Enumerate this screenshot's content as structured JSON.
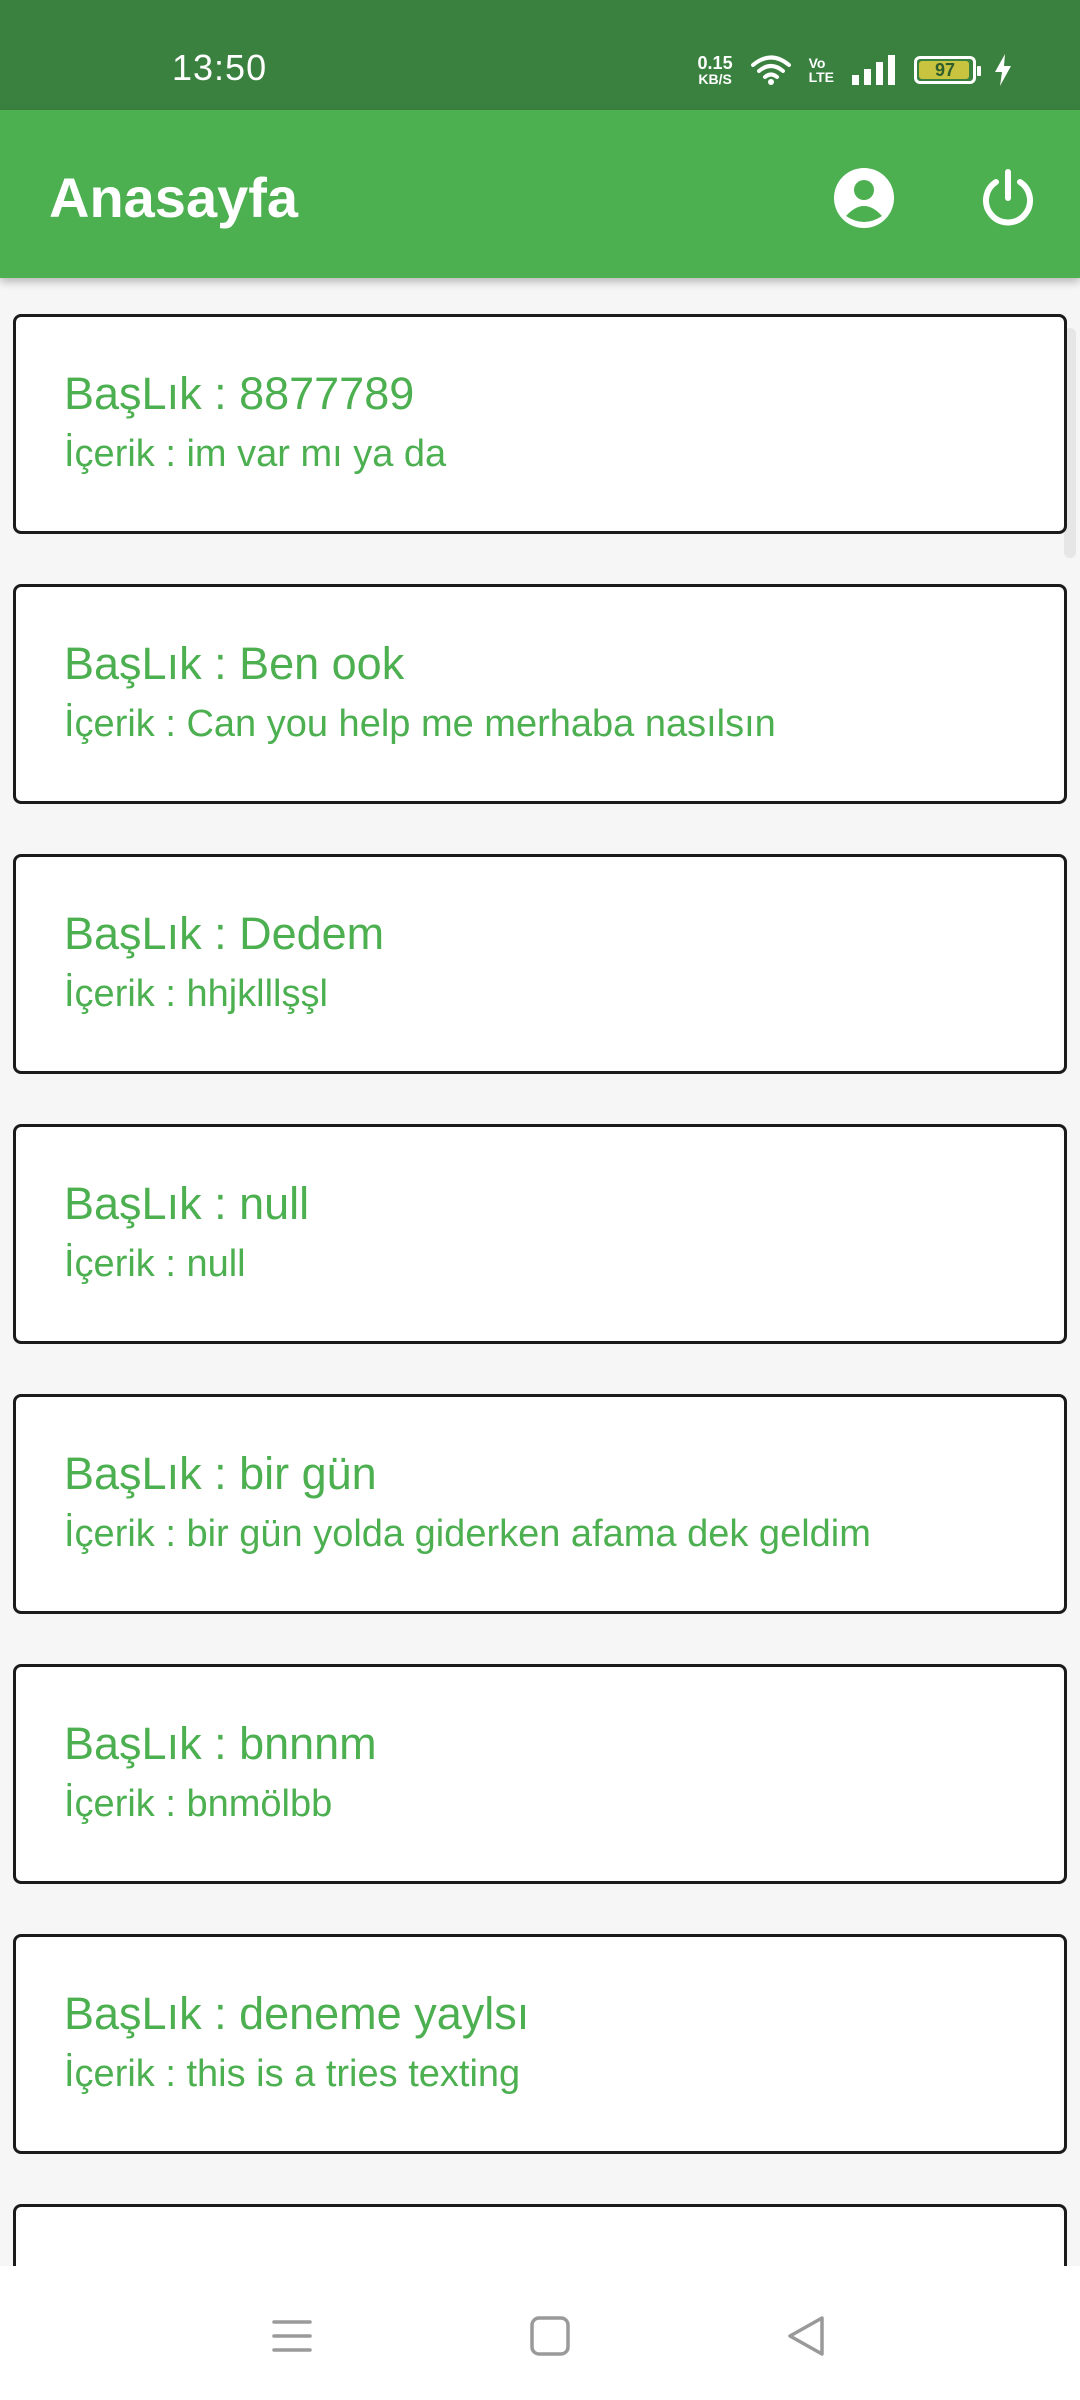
{
  "status_bar": {
    "time": "13:50",
    "net_speed_value": "0.15",
    "net_speed_unit": "KB/S",
    "volte_top": "Vo",
    "volte_bottom": "LTE",
    "battery_level": "97",
    "battery_fraction": 0.97
  },
  "app_bar": {
    "title": "Anasayfa",
    "icons": [
      "account-circle-icon",
      "power-icon"
    ]
  },
  "notes": [
    {
      "heading": "BaşLık :  8877789",
      "content": "İçerik :  im var mı ya da"
    },
    {
      "heading": "BaşLık :  Ben ook",
      "content": "İçerik :  Can you help me merhaba nasılsın"
    },
    {
      "heading": "BaşLık :  Dedem",
      "content": "İçerik :  hhjklllşşl"
    },
    {
      "heading": "BaşLık :  null",
      "content": "İçerik :  null"
    },
    {
      "heading": "BaşLık :  bir gün",
      "content": "İçerik :  bir gün yolda giderken afama dek geldim"
    },
    {
      "heading": "BaşLık :  bnnnm",
      "content": "İçerik :  bnmölbb"
    },
    {
      "heading": "BaşLık :  deneme yaylsı",
      "content": "İçerik :  this is a tries texting"
    },
    {
      "heading": "",
      "content": ""
    }
  ],
  "colors": {
    "status_bar": "#3a813f",
    "app_bar": "#4caf50",
    "text_accent": "#4caf50",
    "card_border": "#1b1b1b"
  },
  "nav_bar": {
    "icons": [
      "menu-icon",
      "home-square-icon",
      "back-triangle-icon"
    ]
  }
}
